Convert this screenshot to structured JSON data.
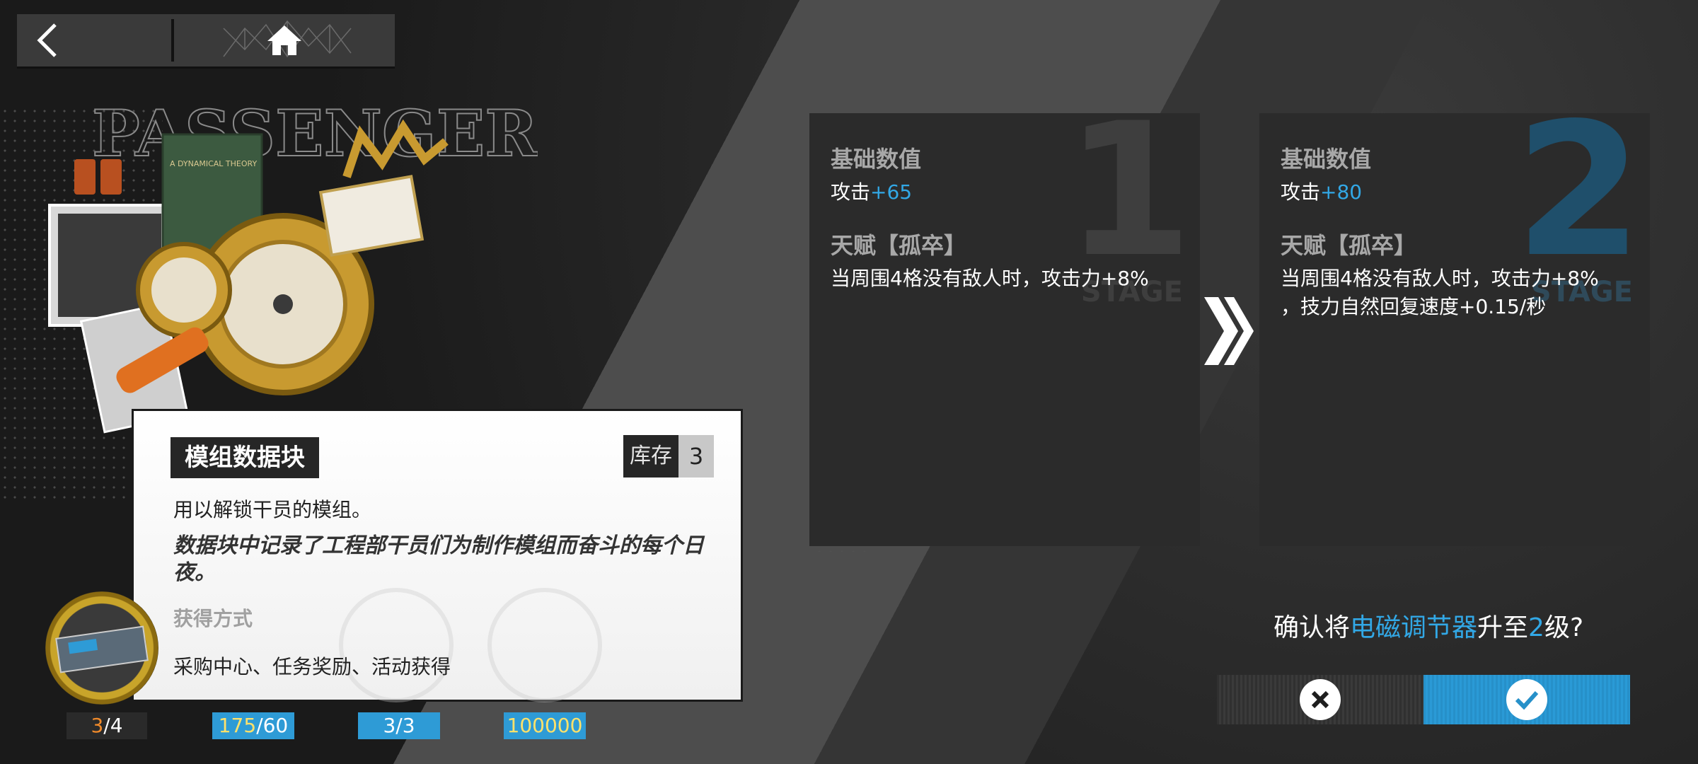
{
  "nav": {
    "back_icon": "chevron-left-icon",
    "home_icon": "home-icon"
  },
  "item": {
    "name": "模组数据块",
    "stock_label": "库存",
    "stock_count": "3",
    "usage": "用以解锁干员的模组。",
    "description": "数据块中记录了工程部干员们为制作模组而奋斗的每个日夜。",
    "obtain_title": "获得方式",
    "obtain_text": "采购中心、任务奖励、活动获得"
  },
  "materials": {
    "m1_have": "3",
    "m1_need": "/4",
    "m2_have": "175",
    "m2_need": "/60",
    "m3": "3/3",
    "m4": "100000"
  },
  "stage1": {
    "number": "1",
    "word": "STAGE",
    "base_title": "基础数值",
    "atk_label": "攻击",
    "atk_value": "+65",
    "talent_title": "天赋【孤卒】",
    "talent_line1": "当周围4格没有敌人时，攻击力+8%"
  },
  "stage2": {
    "number": "2",
    "word": "STAGE",
    "base_title": "基础数值",
    "atk_label": "攻击",
    "atk_value": "+80",
    "talent_title": "天赋【孤卒】",
    "talent_line1": "当周围4格没有敌人时，攻击力+8%",
    "talent_line2": "，技力自然回复速度+0.15/秒"
  },
  "confirm": {
    "prefix": "确认将",
    "module": "电磁调节器",
    "mid": "升至",
    "level": "2",
    "suffix": "级?",
    "cancel_icon": "close-icon",
    "ok_icon": "check-icon"
  },
  "colors": {
    "accent_blue": "#2e9bd6",
    "text_blue": "#32a8e6",
    "orange": "#f08a2a"
  }
}
